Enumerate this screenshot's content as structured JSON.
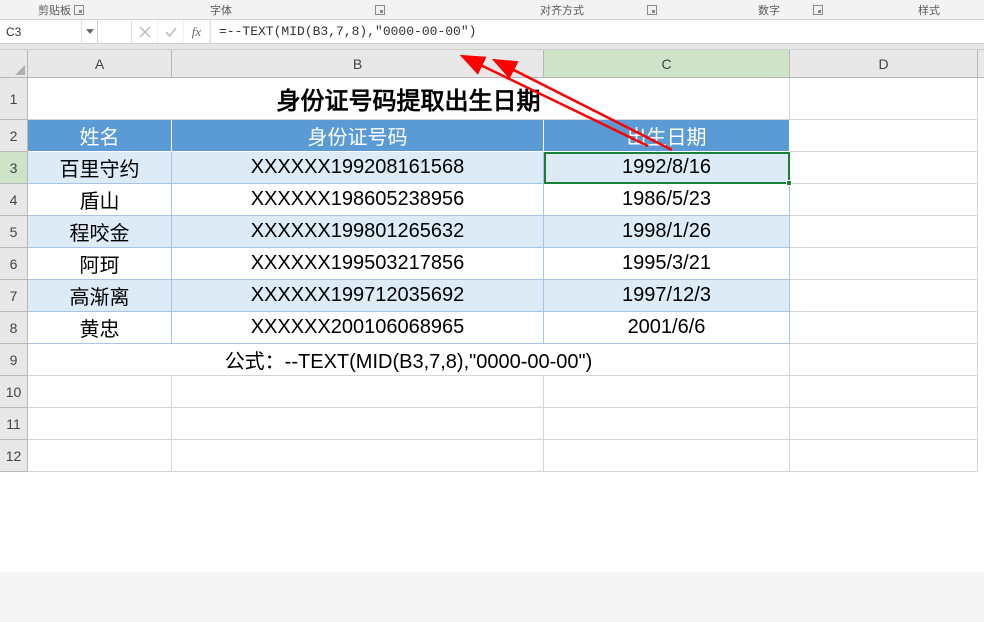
{
  "ribbon": {
    "groups": {
      "clipboard": "剪贴板",
      "font": "字体",
      "alignment": "对齐方式",
      "number": "数字",
      "styles": "样式"
    }
  },
  "formula_bar": {
    "cell_ref": "C3",
    "formula": "=--TEXT(MID(B3,7,8),\"0000-00-00\")"
  },
  "columns": [
    "A",
    "B",
    "C",
    "D"
  ],
  "row_heights": {
    "title": 42,
    "header": 32,
    "data": 32,
    "normal": 32
  },
  "selected_cell": {
    "col": "C",
    "row": 3
  },
  "title": "身份证号码提取出生日期",
  "table": {
    "headers": {
      "name": "姓名",
      "id": "身份证号码",
      "dob": "出生日期"
    },
    "rows": [
      {
        "name": "百里守约",
        "id": "XXXXXX199208161568",
        "dob": "1992/8/16"
      },
      {
        "name": "盾山",
        "id": "XXXXXX198605238956",
        "dob": "1986/5/23"
      },
      {
        "name": "程咬金",
        "id": "XXXXXX199801265632",
        "dob": "1998/1/26"
      },
      {
        "name": "阿珂",
        "id": "XXXXXX199503217856",
        "dob": "1995/3/21"
      },
      {
        "name": "高渐离",
        "id": "XXXXXX199712035692",
        "dob": "1997/12/3"
      },
      {
        "name": "黄忠",
        "id": "XXXXXX200106068965",
        "dob": "2001/6/6"
      }
    ]
  },
  "formula_note": "公式：--TEXT(MID(B3,7,8),\"0000-00-00\")",
  "visible_rows": [
    1,
    2,
    3,
    4,
    5,
    6,
    7,
    8,
    9,
    10,
    11,
    12
  ],
  "chart_data": {
    "type": "table",
    "title": "身份证号码提取出生日期",
    "columns": [
      "姓名",
      "身份证号码",
      "出生日期"
    ],
    "rows": [
      [
        "百里守约",
        "XXXXXX199208161568",
        "1992/8/16"
      ],
      [
        "盾山",
        "XXXXXX198605238956",
        "1986/5/23"
      ],
      [
        "程咬金",
        "XXXXXX199801265632",
        "1998/1/26"
      ],
      [
        "阿珂",
        "XXXXXX199503217856",
        "1995/3/21"
      ],
      [
        "高渐离",
        "XXXXXX199712035692",
        "1997/12/3"
      ],
      [
        "黄忠",
        "XXXXXX200106068965",
        "2001/6/6"
      ]
    ],
    "formula": "=--TEXT(MID(B3,7,8),\"0000-00-00\")"
  }
}
